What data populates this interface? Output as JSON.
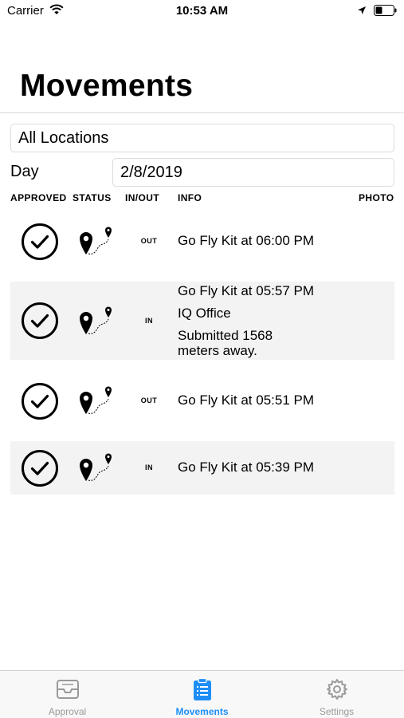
{
  "status_bar": {
    "carrier": "Carrier",
    "time": "10:53 AM"
  },
  "page": {
    "title": "Movements"
  },
  "filters": {
    "location": "All Locations",
    "day_label": "Day",
    "day_value": "2/8/2019"
  },
  "columns": {
    "approved": "APPROVED",
    "status": "STATUS",
    "inout": "IN/OUT",
    "info": "INFO",
    "photo": "PHOTO"
  },
  "rows": [
    {
      "inout": "OUT",
      "info_lines": [
        "Go Fly Kit at 06:00 PM"
      ]
    },
    {
      "inout": "IN",
      "info_lines": [
        "Go Fly Kit at 05:57 PM",
        "IQ Office",
        "Submitted 1568",
        "meters away."
      ]
    },
    {
      "inout": "OUT",
      "info_lines": [
        "Go Fly Kit at 05:51 PM"
      ]
    },
    {
      "inout": "IN",
      "info_lines": [
        "Go Fly Kit at 05:39 PM"
      ]
    }
  ],
  "tab_bar": {
    "tabs": [
      {
        "label": "Approval",
        "icon": "inbox-tray-icon",
        "active": false
      },
      {
        "label": "Movements",
        "icon": "clipboard-list-icon",
        "active": true
      },
      {
        "label": "Settings",
        "icon": "gear-icon",
        "active": false
      }
    ]
  },
  "colors": {
    "accent": "#1e8ef6",
    "row_shade": "#f3f3f3",
    "inactive_tab": "#9a9a9a"
  }
}
